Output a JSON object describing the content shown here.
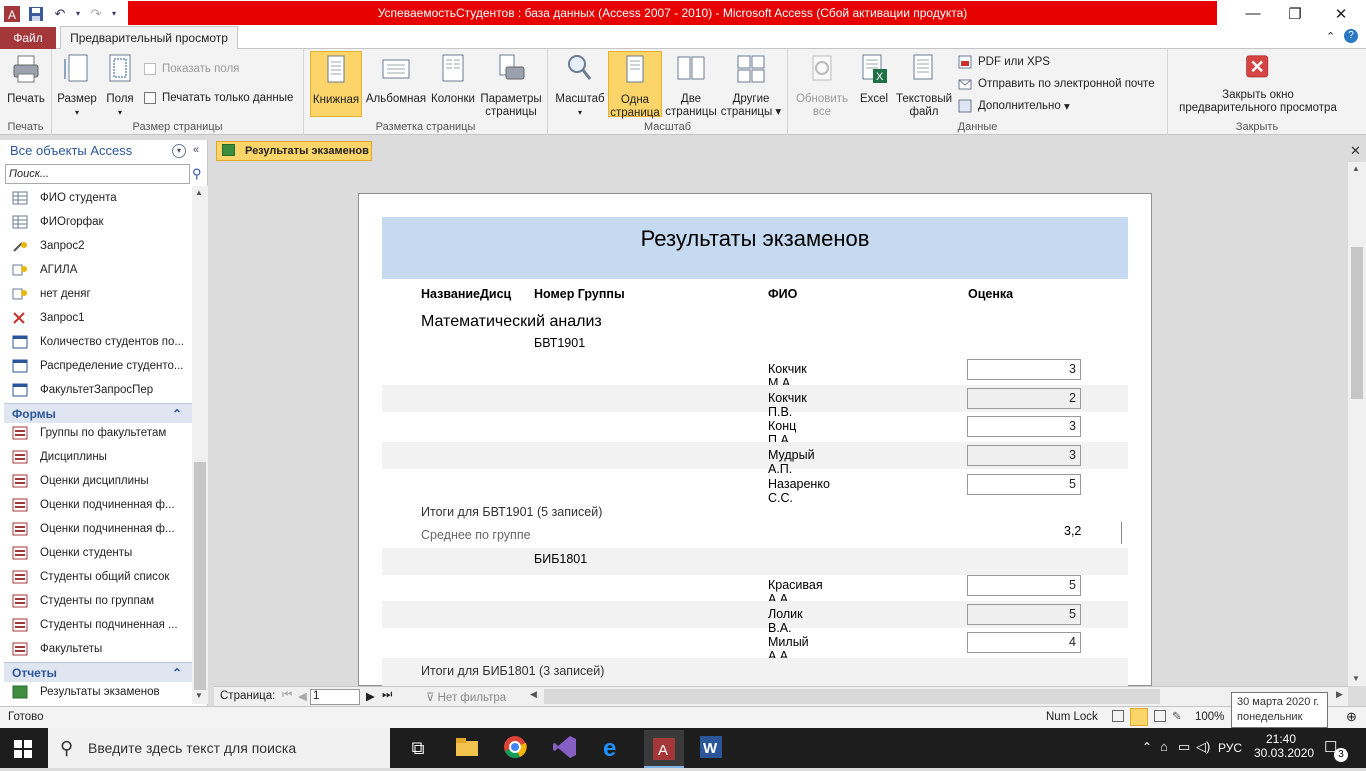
{
  "window": {
    "title": "УспеваемостьСтудентов : база данных (Access 2007 - 2010)  -  Microsoft Access (Сбой активации продукта)"
  },
  "tabs": {
    "file": "Файл",
    "preview": "Предварительный просмотр"
  },
  "ribbon": {
    "groups": {
      "print": "Печать",
      "page_size": "Размер страницы",
      "page_layout": "Разметка страницы",
      "zoom": "Масштаб",
      "data": "Данные",
      "close": "Закрыть"
    },
    "print_btn": "Печать",
    "size_btn": "Размер",
    "margins_btn": "Поля",
    "show_margins": "Показать поля",
    "print_data_only": "Печатать только данные",
    "portrait": "Книжная",
    "landscape": "Альбомная",
    "columns": "Колонки",
    "page_setup_1": "Параметры",
    "page_setup_2": "страницы",
    "zoom_btn": "Масштаб",
    "one_page_1": "Одна",
    "one_page_2": "страница",
    "two_pages_1": "Две",
    "two_pages_2": "страницы",
    "more_pages_1": "Другие",
    "more_pages_2": "страницы",
    "refresh_1": "Обновить",
    "refresh_2": "все",
    "excel": "Excel",
    "text_file_1": "Текстовый",
    "text_file_2": "файл",
    "pdf": "PDF или XPS",
    "email": "Отправить по электронной почте",
    "more": "Дополнительно",
    "close_preview_1": "Закрыть окно",
    "close_preview_2": "предварительного просмотра"
  },
  "nav": {
    "header": "Все объекты Access",
    "search_placeholder": "Поиск...",
    "queries": [
      {
        "label": "ФИО студента",
        "icon": "table-query-icon"
      },
      {
        "label": "ФИОгорфак",
        "icon": "table-query-icon"
      },
      {
        "label": "Запрос2",
        "icon": "update-query-icon"
      },
      {
        "label": "АГИЛА",
        "icon": "append-query-icon"
      },
      {
        "label": "нет деняг",
        "icon": "append-query-icon"
      },
      {
        "label": "Запрос1",
        "icon": "delete-query-icon"
      },
      {
        "label": "Количество студентов по...",
        "icon": "crosstab-query-icon"
      },
      {
        "label": "Распределение студенто...",
        "icon": "crosstab-query-icon"
      },
      {
        "label": "ФакультетЗапросПер",
        "icon": "crosstab-query-icon"
      }
    ],
    "forms_header": "Формы",
    "forms": [
      "Группы по факультетам",
      "Дисциплины",
      "Оценки дисциплины",
      "Оценки подчиненная ф...",
      "Оценки подчиненная ф...",
      "Оценки студенты",
      "Студенты общий список",
      "Студенты по группам",
      "Студенты подчиненная ...",
      "Факультеты"
    ],
    "reports_header": "Отчеты",
    "reports": [
      "Результаты экзаменов"
    ]
  },
  "document": {
    "tab_label": "Результаты экзаменов",
    "report": {
      "title": "Результаты экзаменов",
      "columns": [
        "НазваниеДисц",
        "Номер Группы",
        "ФИО",
        "Оценка"
      ],
      "discipline": "Математический анализ",
      "group1": "БВТ1901",
      "group1_rows": [
        {
          "fio": "Кокчик М.А.",
          "score": "3"
        },
        {
          "fio": "Кокчик П.В.",
          "score": "2"
        },
        {
          "fio": "Конц П.А.",
          "score": "3"
        },
        {
          "fio": "Мудрый А.П.",
          "score": "3"
        },
        {
          "fio": "Назаренко С.С.",
          "score": "5"
        }
      ],
      "group1_total": "Итоги для БВТ1901 (5 записей)",
      "avg_label": "Среднее по группе",
      "group1_avg": "3,2",
      "group2": "БИБ1801",
      "group2_rows": [
        {
          "fio": "Красивая А.А.",
          "score": "5"
        },
        {
          "fio": "Лолик В.А.",
          "score": "5"
        },
        {
          "fio": "Милый А.А.",
          "score": "4"
        }
      ],
      "group2_total": "Итоги для БИБ1801 (3 записей)"
    }
  },
  "recordbar": {
    "page_label": "Страница:",
    "page_value": "1",
    "filter": "Нет фильтра"
  },
  "statusbar": {
    "ready": "Готово",
    "numlock": "Num Lock",
    "zoom": "100%"
  },
  "tooltip": {
    "line1": "30 марта 2020 г.",
    "line2": "понедельник"
  },
  "taskbar": {
    "search_placeholder": "Введите здесь текст для поиска",
    "language": "РУС",
    "time": "21:40",
    "date": "30.03.2020",
    "notifications": "3"
  },
  "colors": {
    "title_bar": "#e60000",
    "file_tab": "#a4373a",
    "highlight": "#fbd46a",
    "report_header": "#c5d9f1",
    "nav_accent": "#2b579a"
  }
}
